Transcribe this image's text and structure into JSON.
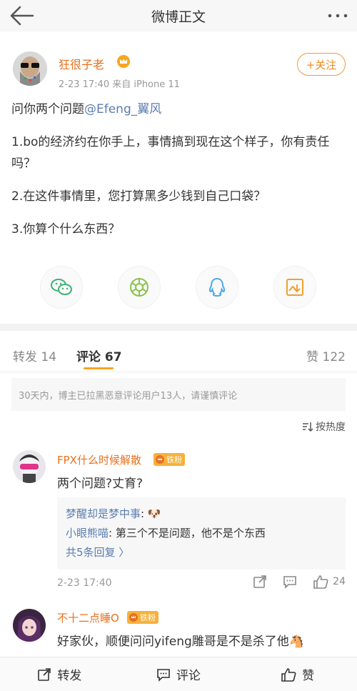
{
  "header": {
    "title": "微博正文"
  },
  "post": {
    "author": "狂很子老",
    "meta": "2-23 17:40 来自 iPhone 11",
    "follow_label": "+关注",
    "lines": [
      "问你两个问题",
      "@Efeng_翼风",
      "1.bo的经济约在你手上，事情搞到现在这个样子，你有责任吗？",
      "2.在这件事情里，您打算黑多少钱到自己口袋？",
      "3.你算个什么东西？"
    ]
  },
  "share": [
    "wechat-icon",
    "moments-icon",
    "qq-icon",
    "save-image-icon"
  ],
  "tabs": {
    "repost": "转发 14",
    "comments": "评论 67",
    "likes": "赞 122"
  },
  "notice": "30天内，博主已拉黑恶意评论用户13人，请谨慎评论",
  "sort_label": "按热度",
  "comments": [
    {
      "name": "FPX什么时候解散",
      "badge": "铁粉",
      "text": "两个问题?丈育?",
      "replies": [
        {
          "name": "梦醒却是梦中事",
          "text": ": 🐶"
        },
        {
          "name": "小眼熊喵",
          "text": ": 第三个不是问题，他不是个东西"
        }
      ],
      "more": "共5条回复 〉",
      "time": "2-23 17:40",
      "likes": "24"
    },
    {
      "name": "不十二点睡O",
      "badge": "铁粉",
      "text": "好家伙，顺便问问yifeng雕哥是不是杀了他🐴"
    }
  ],
  "bottom_bar": {
    "repost": "转发",
    "comment": "评论",
    "like": "赞"
  },
  "colors": {
    "accent": "#f08a1e",
    "link": "#5b7eb1",
    "badge": "#f6b13c"
  }
}
